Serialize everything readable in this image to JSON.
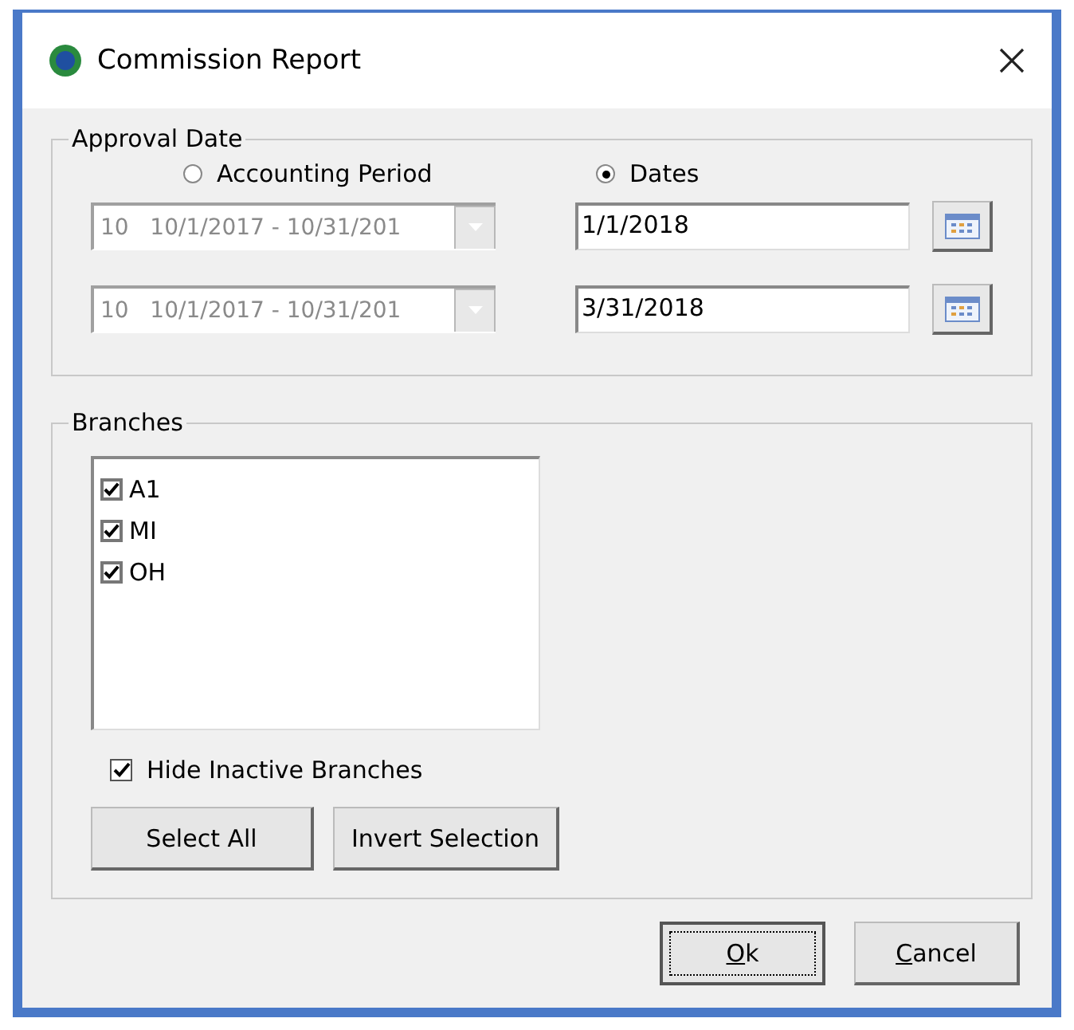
{
  "window": {
    "title": "Commission Report"
  },
  "approval_date": {
    "title": "Approval Date",
    "modes": [
      {
        "label": "Accounting Period",
        "selected": false
      },
      {
        "label": "Dates",
        "selected": true
      }
    ],
    "rows": [
      {
        "period": {
          "value": "10   10/1/2017 - 10/31/201",
          "disabled": true
        },
        "date": "1/1/2018"
      },
      {
        "period": {
          "value": "10   10/1/2017 - 10/31/201",
          "disabled": true
        },
        "date": "3/31/2018"
      }
    ]
  },
  "branches": {
    "title": "Branches",
    "items": [
      {
        "label": "A1",
        "checked": true
      },
      {
        "label": "MI",
        "checked": true
      },
      {
        "label": "OH",
        "checked": true
      }
    ],
    "hide_inactive": {
      "label": "Hide Inactive Branches",
      "checked": true
    },
    "buttons": [
      "Select All",
      "Invert Selection"
    ]
  },
  "footer_buttons": [
    {
      "label": "Ok",
      "focused": true,
      "mnemonic_underline": true
    },
    {
      "label": "Cancel",
      "focused": false,
      "mnemonic_underline": true
    }
  ]
}
